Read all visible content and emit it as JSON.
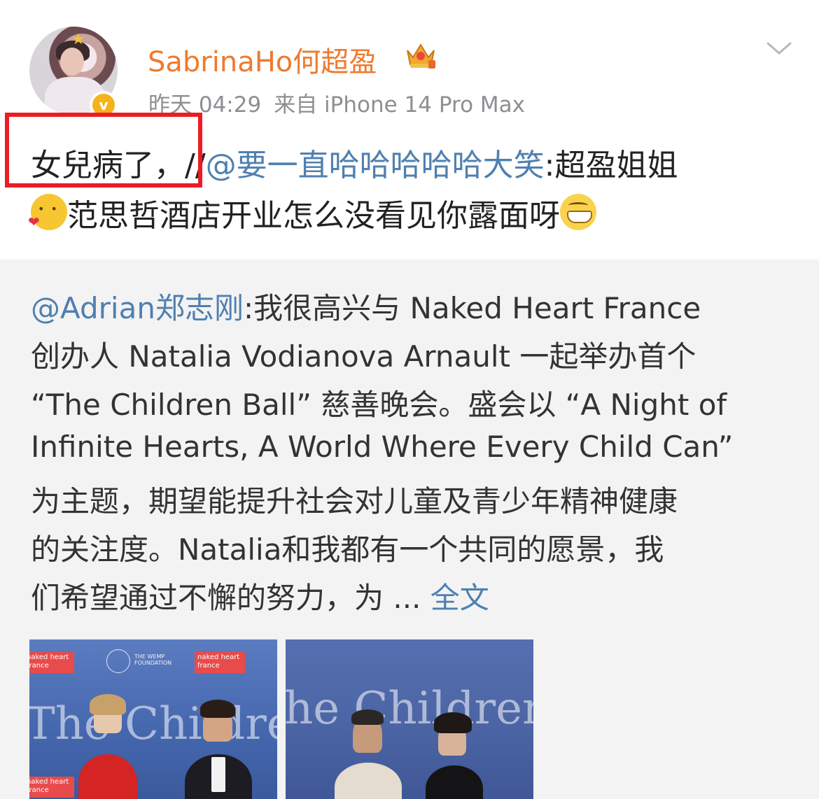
{
  "header": {
    "username": "SabrinaHo何超盈",
    "time": "昨天 04:29",
    "source": "来自 iPhone 14 Pro Max",
    "verified_glyph": "v"
  },
  "post": {
    "highlighted_text": "女兒病了，",
    "repost_prefix": "//",
    "mention": "@要一直哈哈哈哈哈大笑",
    "after_mention": ":超盈姐姐",
    "line2_text": "范思哲酒店开业怎么没看见你露面呀"
  },
  "retweet": {
    "mention": "@Adrian郑志刚",
    "lines": [
      ":我很高兴与 Naked Heart France",
      "创办人 Natalia Vodianova Arnault 一起举办首个",
      "“The Children Ball” 慈善晚会。盛会以 “A Night of",
      "Infinite Hearts, A World Where Every Child Can”",
      "为主题，期望能提升社会对儿童及青少年精神健康",
      "的关注度。Natalia和我都有一个共同的愿景，我",
      "们希望通过不懈的努力，为 ... "
    ],
    "more_label": "全文"
  },
  "photos": {
    "banner1": "The Children B",
    "banner2": "he Children",
    "tag_label": "naked heart france",
    "logo_text": "THE WEMP FOUNDATION"
  },
  "icons": {
    "crown": "crown-badge-icon",
    "chevron": "chevron-down-icon",
    "emoji_love": "love-struck-emoji-icon",
    "emoji_grin": "grin-emoji-icon"
  },
  "colors": {
    "username": "#ef7a2d",
    "mention": "#4f80b0",
    "highlight_box": "#ec1c24",
    "retweet_bg": "#f3f3f3"
  }
}
